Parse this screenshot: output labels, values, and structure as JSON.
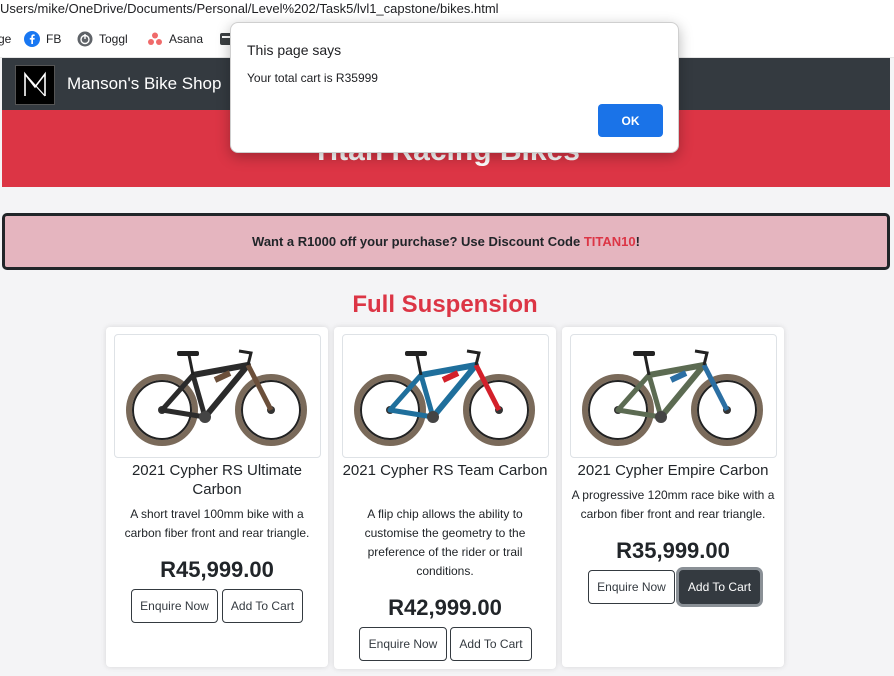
{
  "browser": {
    "url": "Users/mike/OneDrive/Documents/Personal/Level%202/Task5/lvl1_capstone/bikes.html",
    "bookmarks": [
      {
        "label": "ge"
      },
      {
        "label": "FB",
        "icon": "facebook-icon"
      },
      {
        "label": "Toggl",
        "icon": "toggl-icon"
      },
      {
        "label": "Asana",
        "icon": "asana-icon"
      }
    ]
  },
  "dialog": {
    "title": "This page says",
    "message": "Your total cart is R35999",
    "ok_label": "OK"
  },
  "nav": {
    "brand": "Manson's Bike Shop"
  },
  "hero": {
    "title": "Titan Racing Bikes"
  },
  "promo": {
    "text_before": "Want a R1000 off your purchase? Use Discount Code ",
    "code": "TITAN10",
    "text_after": "!"
  },
  "section": {
    "title": "Full Suspension"
  },
  "products": [
    {
      "name": "2021 Cypher RS Ultimate Carbon",
      "description": "A short travel 100mm bike with a carbon fiber front and rear triangle.",
      "price": "R45,999.00",
      "enquire_label": "Enquire Now",
      "cart_label": "Add To Cart",
      "frame_color": "#2b2b2b",
      "accent_color": "#6b4f3a"
    },
    {
      "name": "2021 Cypher RS Team Carbon",
      "description": "A flip chip allows the ability to customise the geometry to the preference of the rider or trail conditions.",
      "price": "R42,999.00",
      "enquire_label": "Enquire Now",
      "cart_label": "Add To Cart",
      "frame_color": "#1f6f9c",
      "accent_color": "#d3202a"
    },
    {
      "name": "2021 Cypher Empire Carbon",
      "description": "A progressive 120mm race bike with a carbon fiber front and rear triangle.",
      "price": "R35,999.00",
      "enquire_label": "Enquire Now",
      "cart_label": "Add To Cart",
      "frame_color": "#5c6b52",
      "accent_color": "#2b6fa3"
    }
  ]
}
